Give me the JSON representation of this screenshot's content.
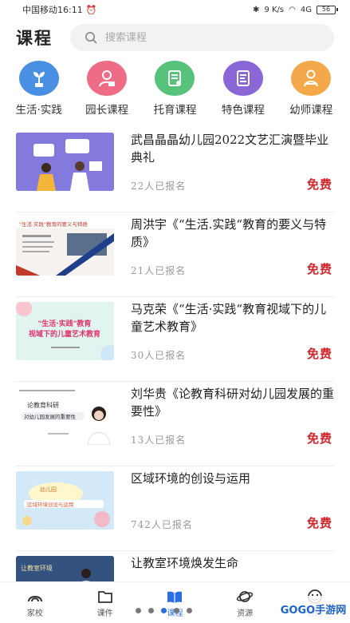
{
  "status": {
    "carrier_time": "中国移动16:11",
    "net_speed_top": "9",
    "net_speed_unit": "K/s",
    "signal": "4G",
    "battery": "56"
  },
  "header": {
    "title": "课程"
  },
  "search": {
    "placeholder": "搜索课程"
  },
  "categories": [
    {
      "label": "生活·实践",
      "color": "#4a90e2"
    },
    {
      "label": "园长课程",
      "color": "#ef6c86"
    },
    {
      "label": "托育课程",
      "color": "#57c27a"
    },
    {
      "label": "特色课程",
      "color": "#8a67d6"
    },
    {
      "label": "幼师课程",
      "color": "#f3a94a"
    }
  ],
  "courses": [
    {
      "title": "武昌晶晶幼儿园2022文艺汇演暨毕业典礼",
      "count": "22人已报名",
      "price": "免费"
    },
    {
      "title": "周洪宇《“生活.实践“教育的要义与特质》",
      "count": "21人已报名",
      "price": "免费",
      "thumb_text": "\"生活.实践\"教育的要义与特质"
    },
    {
      "title": "马克荣《“生活·实践“教育视域下的儿童艺术教育》",
      "count": "30人已报名",
      "price": "免费",
      "thumb_text": "\"生活·实践\"教育 视域下的儿童艺术教育"
    },
    {
      "title": "刘华贵《论教育科研对幼儿园发展的重要性》",
      "count": "13人已报名",
      "price": "免费",
      "thumb_text": "论教育科研 对幼儿园发展的重要性"
    },
    {
      "title": "区域环境的创设与运用",
      "count": "742人已报名",
      "price": "免费",
      "thumb_text": "幼儿园 区域环境创设与运用"
    },
    {
      "title": "让教室环境焕发生命",
      "count": "",
      "price": "",
      "thumb_text": "让教室环境"
    }
  ],
  "nav": [
    {
      "label": "家校",
      "icon": "home-icon"
    },
    {
      "label": "课件",
      "icon": "folder-icon"
    },
    {
      "label": "课程",
      "icon": "book-icon"
    },
    {
      "label": "资源",
      "icon": "planet-icon"
    },
    {
      "label": "我的",
      "icon": "smile-icon"
    }
  ],
  "watermark": "GOGO手游网"
}
